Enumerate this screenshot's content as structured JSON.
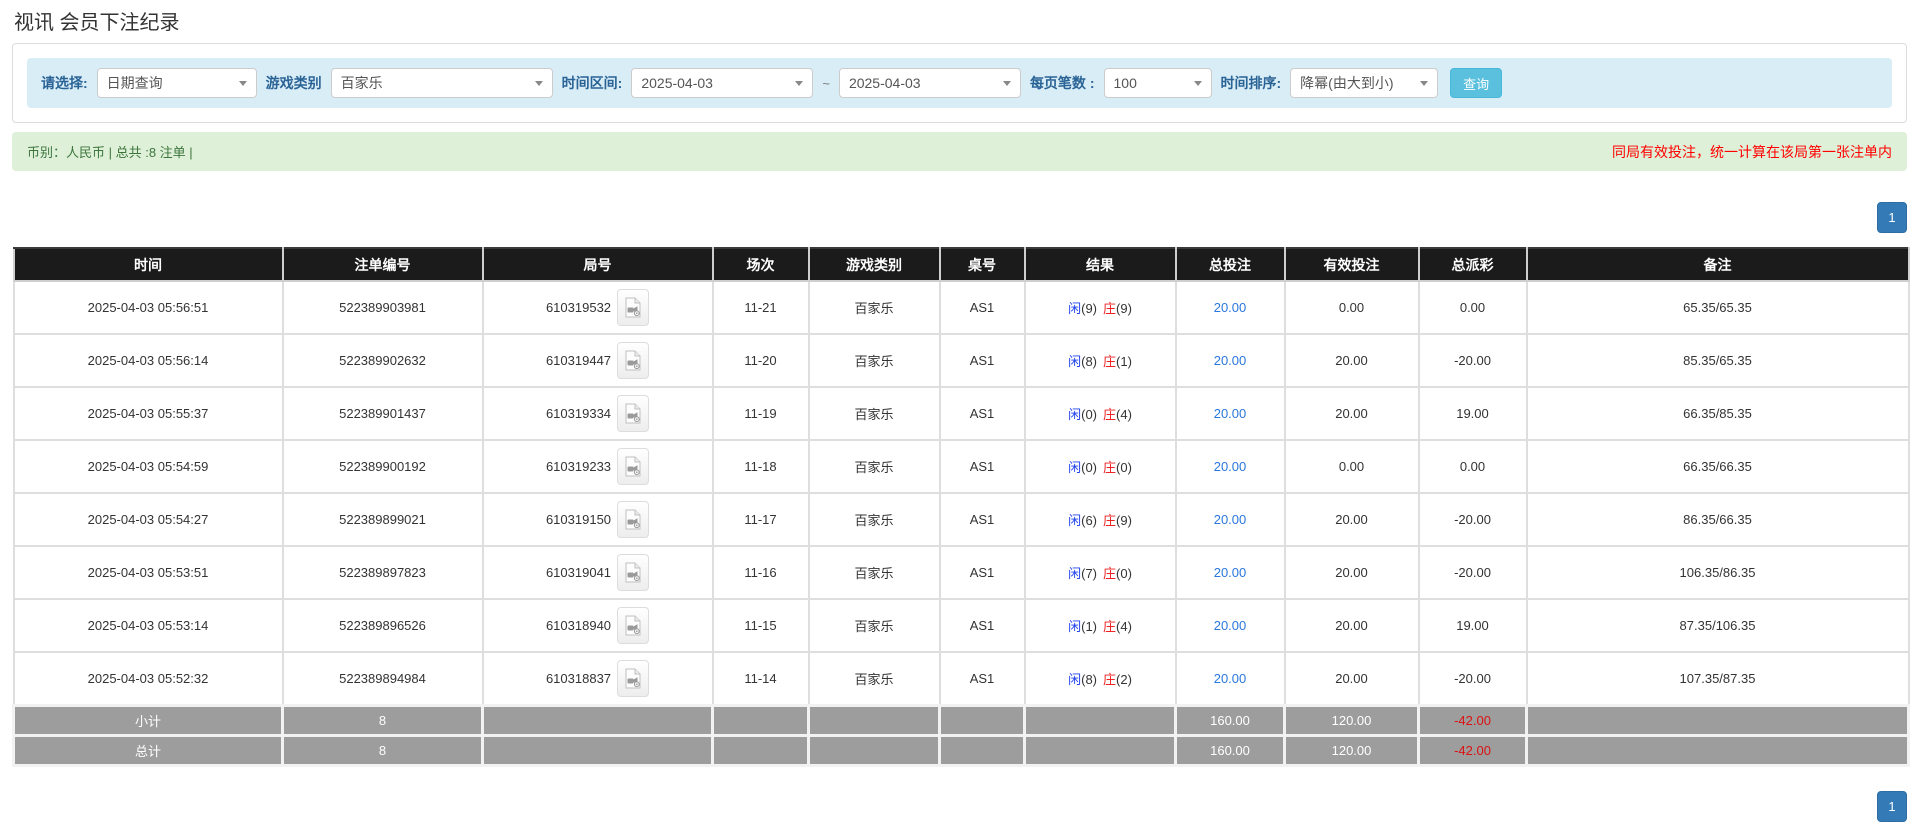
{
  "page": {
    "title": "视讯 会员下注纪录"
  },
  "filters": {
    "select_label": "请选择:",
    "select_value": "日期查询",
    "game_label": "游戏类别",
    "game_value": "百家乐",
    "range_label": "时间区间:",
    "date_from": "2025-04-03",
    "tilde": "~",
    "date_to": "2025-04-03",
    "page_size_label": "每页笔数 :",
    "page_size_value": "100",
    "sort_label": "时间排序:",
    "sort_value": "降幂(由大到小)",
    "search_button": "查询"
  },
  "summary": {
    "left": "币别：人民币 | 总共 :8 注单 |",
    "right_note": "同局有效投注，统一计算在该局第一张注单内"
  },
  "pagination": {
    "page": "1"
  },
  "table": {
    "headers": [
      "时间",
      "注单编号",
      "局号",
      "场次",
      "游戏类别",
      "桌号",
      "结果",
      "总投注",
      "有效投注",
      "总派彩",
      "备注"
    ],
    "rows": [
      {
        "time": "2025-04-03 05:56:51",
        "bet_id": "522389903981",
        "round_id": "610319532",
        "session": "11-21",
        "game": "百家乐",
        "table_no": "AS1",
        "player": "闲",
        "player_n": "(9)",
        "banker": "庄",
        "banker_n": "(9)",
        "total_bet": "20.00",
        "valid_bet": "0.00",
        "payout": "0.00",
        "remark": "65.35/65.35"
      },
      {
        "time": "2025-04-03 05:56:14",
        "bet_id": "522389902632",
        "round_id": "610319447",
        "session": "11-20",
        "game": "百家乐",
        "table_no": "AS1",
        "player": "闲",
        "player_n": "(8)",
        "banker": "庄",
        "banker_n": "(1)",
        "total_bet": "20.00",
        "valid_bet": "20.00",
        "payout": "-20.00",
        "remark": "85.35/65.35"
      },
      {
        "time": "2025-04-03 05:55:37",
        "bet_id": "522389901437",
        "round_id": "610319334",
        "session": "11-19",
        "game": "百家乐",
        "table_no": "AS1",
        "player": "闲",
        "player_n": "(0)",
        "banker": "庄",
        "banker_n": "(4)",
        "total_bet": "20.00",
        "valid_bet": "20.00",
        "payout": "19.00",
        "remark": "66.35/85.35"
      },
      {
        "time": "2025-04-03 05:54:59",
        "bet_id": "522389900192",
        "round_id": "610319233",
        "session": "11-18",
        "game": "百家乐",
        "table_no": "AS1",
        "player": "闲",
        "player_n": "(0)",
        "banker": "庄",
        "banker_n": "(0)",
        "total_bet": "20.00",
        "valid_bet": "0.00",
        "payout": "0.00",
        "remark": "66.35/66.35"
      },
      {
        "time": "2025-04-03 05:54:27",
        "bet_id": "522389899021",
        "round_id": "610319150",
        "session": "11-17",
        "game": "百家乐",
        "table_no": "AS1",
        "player": "闲",
        "player_n": "(6)",
        "banker": "庄",
        "banker_n": "(9)",
        "total_bet": "20.00",
        "valid_bet": "20.00",
        "payout": "-20.00",
        "remark": "86.35/66.35"
      },
      {
        "time": "2025-04-03 05:53:51",
        "bet_id": "522389897823",
        "round_id": "610319041",
        "session": "11-16",
        "game": "百家乐",
        "table_no": "AS1",
        "player": "闲",
        "player_n": "(7)",
        "banker": "庄",
        "banker_n": "(0)",
        "total_bet": "20.00",
        "valid_bet": "20.00",
        "payout": "-20.00",
        "remark": "106.35/86.35"
      },
      {
        "time": "2025-04-03 05:53:14",
        "bet_id": "522389896526",
        "round_id": "610318940",
        "session": "11-15",
        "game": "百家乐",
        "table_no": "AS1",
        "player": "闲",
        "player_n": "(1)",
        "banker": "庄",
        "banker_n": "(4)",
        "total_bet": "20.00",
        "valid_bet": "20.00",
        "payout": "19.00",
        "remark": "87.35/106.35"
      },
      {
        "time": "2025-04-03 05:52:32",
        "bet_id": "522389894984",
        "round_id": "610318837",
        "session": "11-14",
        "game": "百家乐",
        "table_no": "AS1",
        "player": "闲",
        "player_n": "(8)",
        "banker": "庄",
        "banker_n": "(2)",
        "total_bet": "20.00",
        "valid_bet": "20.00",
        "payout": "-20.00",
        "remark": "107.35/87.35"
      }
    ],
    "subtotal": {
      "label": "小计",
      "count": "8",
      "total_bet": "160.00",
      "valid_bet": "120.00",
      "payout": "-42.00"
    },
    "total": {
      "label": "总计",
      "count": "8",
      "total_bet": "160.00",
      "valid_bet": "120.00",
      "payout": "-42.00"
    }
  },
  "icons": {
    "video_file": "video-file-icon",
    "chevron": "chevron-down-icon"
  },
  "colors": {
    "header_bg": "#1b1b1b",
    "primary_blue": "#337ab7",
    "primary_blue_border": "#2e6da4",
    "info_btn": "#5bc0de",
    "info_btn_border": "#46b8da",
    "link_blue": "#2a77dd",
    "player_blue": "#2244ee",
    "banker_red": "#ee2222",
    "negative_red": "#ff0000",
    "success_bg": "#dff0d8",
    "success_text": "#3c763d",
    "info_bg": "#d9edf7",
    "label_blue": "#2a6496",
    "total_row_bg": "#9d9d9d"
  }
}
